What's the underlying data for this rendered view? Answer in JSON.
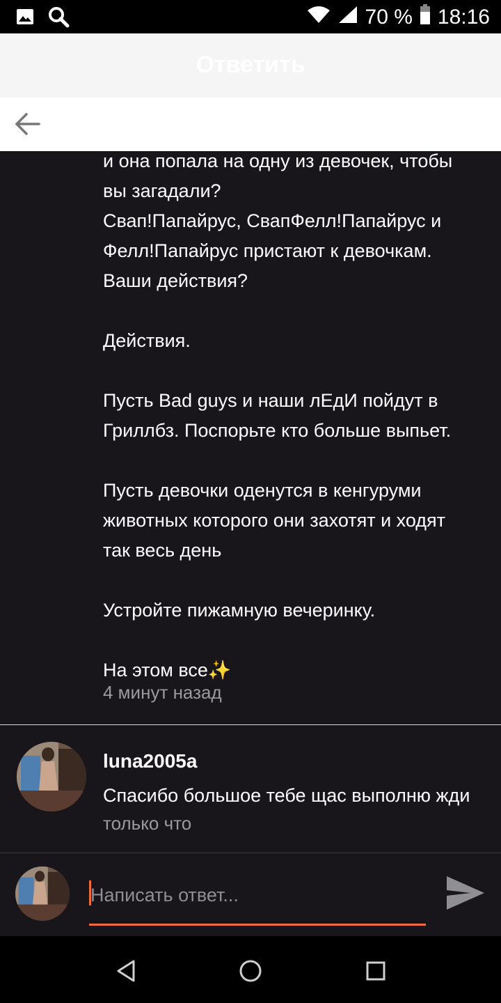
{
  "status_bar": {
    "battery": "70 %",
    "time": "18:16"
  },
  "header": {
    "title": "Ответить"
  },
  "post": {
    "text": "и она попала на одну из девочек, чтобы\nвы загадали?\nСвап!Папайрус, СвапФелл!Папайрус и\nФелл!Папайрус пристают к девочкам.\nВаши действия?\n\nДействия.\n\nПусть Bad guys и наши лЕдИ пойдут в\nГриллбз. Поспорьте кто больше выпьет.\n\nПусть девочки оденутся в кенгуруми\nживотных которого они захотят и ходят\nтак весь день\n\nУстройте пижамную вечеринку.\n\nНа этом все✨",
    "time": "4 минут назад"
  },
  "reply": {
    "username": "luna2005a",
    "text": "Спасибо большое тебе щас выполню жди",
    "time": "только что"
  },
  "composer": {
    "placeholder": "Написать ответ..."
  },
  "colors": {
    "accent": "#f26a3b",
    "background": "#18161a"
  }
}
